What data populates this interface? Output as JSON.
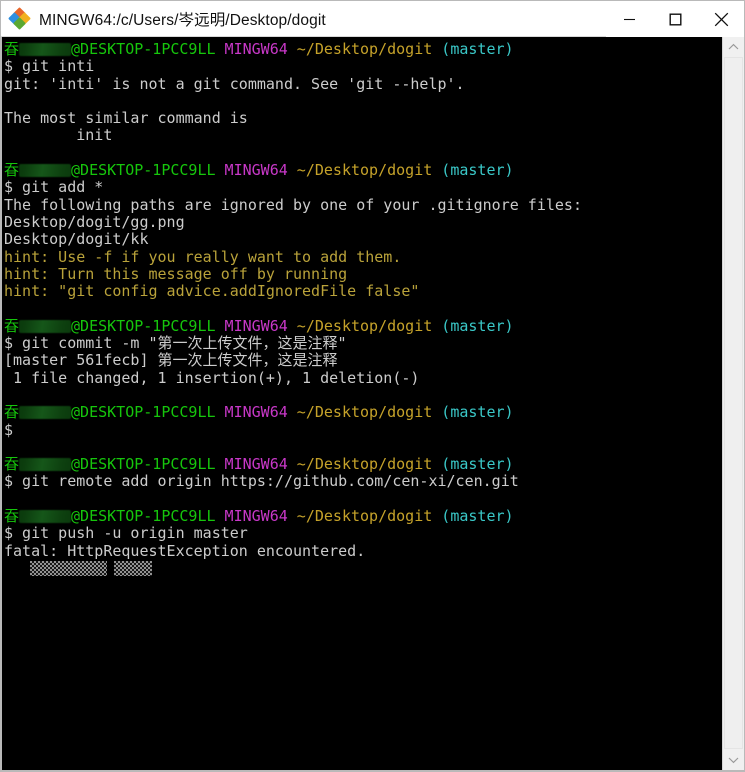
{
  "window": {
    "title": "MINGW64:/c/Users/岑远明/Desktop/dogit",
    "app_icon": "mingw-diamonds-icon",
    "controls": {
      "minimize": "minimize-icon",
      "maximize": "maximize-icon",
      "close": "close-icon"
    }
  },
  "colors": {
    "background": "#000000",
    "foreground": "#cccccc",
    "prompt_user": "#16c60c",
    "prompt_shell": "#c838c8",
    "prompt_path": "#c5a22a",
    "prompt_branch": "#3ac8c8",
    "hint": "#b9a23a",
    "titlebar_bg": "#ffffff",
    "scrollbar_bg": "#f0f0f0"
  },
  "terminal": {
    "prompt": {
      "user_redacted": "",
      "host": "@DESKTOP-1PCC9LL",
      "shell": "MINGW64",
      "path": "~/Desktop/dogit",
      "branch": "(master)",
      "symbol": "$"
    },
    "blocks": [
      {
        "command": "$ git inti",
        "output": [
          {
            "text": "git: 'inti' is not a git command. See 'git --help'.",
            "color": "white"
          },
          {
            "text": "",
            "color": "white"
          },
          {
            "text": "The most similar command is",
            "color": "white"
          },
          {
            "text": "        init",
            "color": "white"
          }
        ]
      },
      {
        "command": "$ git add *",
        "output": [
          {
            "text": "The following paths are ignored by one of your .gitignore files:",
            "color": "white"
          },
          {
            "text": "Desktop/dogit/gg.png",
            "color": "white"
          },
          {
            "text": "Desktop/dogit/kk",
            "color": "white"
          },
          {
            "text": "hint: Use -f if you really want to add them.",
            "color": "hint"
          },
          {
            "text": "hint: Turn this message off by running",
            "color": "hint"
          },
          {
            "text": "hint: \"git config advice.addIgnoredFile false\"",
            "color": "hint"
          }
        ]
      },
      {
        "command": "$ git commit -m \"第一次上传文件，这是注释\"",
        "output": [
          {
            "text": "[master 561fecb] 第一次上传文件，这是注释",
            "color": "white"
          },
          {
            "text": " 1 file changed, 1 insertion(+), 1 deletion(-)",
            "color": "white"
          }
        ]
      },
      {
        "command": "$",
        "output": []
      },
      {
        "command": "$ git remote add origin https://github.com/cen-xi/cen.git",
        "output": []
      },
      {
        "command": "$ git push -u origin master",
        "output": [
          {
            "text": "fatal: HttpRequestException encountered.",
            "color": "white"
          },
          {
            "text": "",
            "color": "mosaic"
          }
        ]
      }
    ]
  },
  "scrollbar": {
    "up_arrow": "chevron-up-icon",
    "down_arrow": "chevron-down-icon",
    "position": "top"
  }
}
